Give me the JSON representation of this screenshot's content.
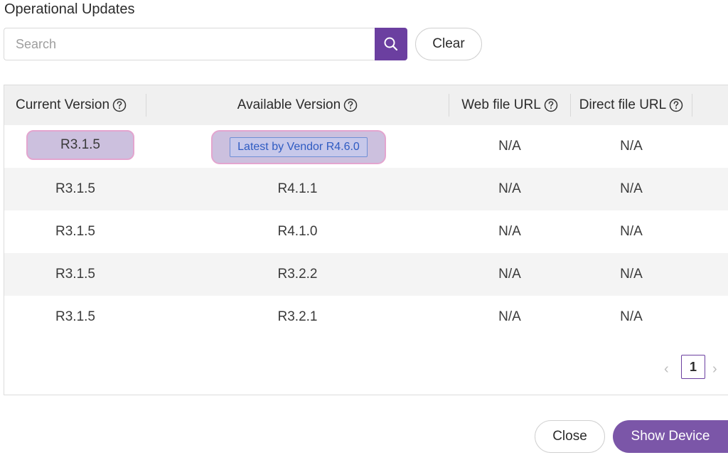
{
  "dialog": {
    "title": "Operational Updates"
  },
  "search": {
    "placeholder": "Search",
    "value": "",
    "clear_label": "Clear"
  },
  "table": {
    "columns": [
      "Current Version",
      "Available Version",
      "Web file URL",
      "Direct file URL"
    ],
    "rows": [
      {
        "current": "R3.1.5",
        "available": "Latest by Vendor R4.6.0",
        "web_url": "N/A",
        "direct_url": "N/A",
        "highlighted": true
      },
      {
        "current": "R3.1.5",
        "available": "R4.1.1",
        "web_url": "N/A",
        "direct_url": "N/A"
      },
      {
        "current": "R3.1.5",
        "available": "R4.1.0",
        "web_url": "N/A",
        "direct_url": "N/A"
      },
      {
        "current": "R3.1.5",
        "available": "R3.2.2",
        "web_url": "N/A",
        "direct_url": "N/A"
      },
      {
        "current": "R3.1.5",
        "available": "R3.2.1",
        "web_url": "N/A",
        "direct_url": "N/A"
      }
    ]
  },
  "pagination": {
    "current_page": "1",
    "prev_icon": "‹",
    "next_icon": "›"
  },
  "footer": {
    "close_label": "Close",
    "show_device_label": "Show Device"
  },
  "colors": {
    "accent": "#6b3fa0",
    "highlight_fill": "#ccc0de",
    "highlight_border": "#e3a5cf",
    "vendor_tag_text": "#2f5bc2"
  },
  "icons": {
    "search": "search-icon",
    "help": "question-circle-icon"
  }
}
